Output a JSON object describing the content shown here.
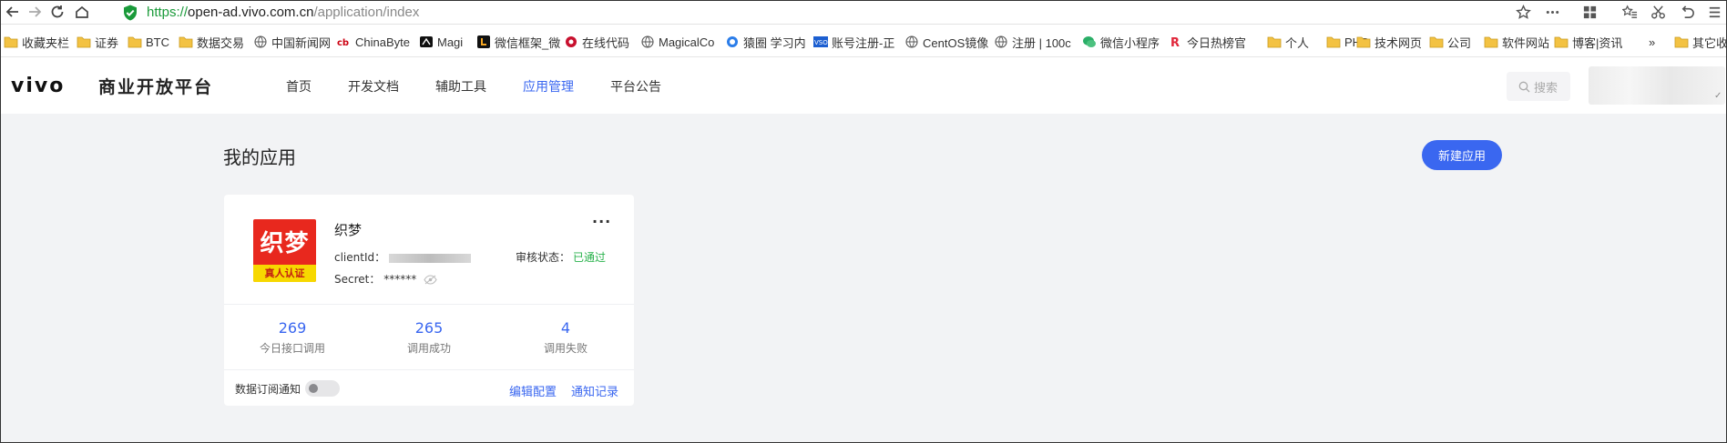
{
  "browser": {
    "url_scheme": "https://",
    "url_host": "open-ad.vivo.com.cn",
    "url_path": "/application/index",
    "icons": {
      "back": "arrow-left-icon",
      "forward": "arrow-right-icon",
      "reload": "reload-icon",
      "home": "home-icon",
      "secure": "shield-check-icon",
      "star": "star-icon",
      "menu_more": "more-icon",
      "apps": "grid-icon",
      "favorites": "favorites-icon",
      "cut": "scissors-icon",
      "undo": "undo-icon",
      "main_menu": "hamburger-icon"
    }
  },
  "bookmarks": [
    {
      "label": "收藏夹栏",
      "icon": "folder-icon"
    },
    {
      "label": "证券",
      "icon": "folder-icon"
    },
    {
      "label": "BTC",
      "icon": "folder-icon"
    },
    {
      "label": "数据交易",
      "icon": "folder-icon"
    },
    {
      "label": "中国新闻网",
      "icon": "globe-icon"
    },
    {
      "label": "ChinaByte",
      "icon": "cb-icon"
    },
    {
      "label": "Magi",
      "icon": "magi-icon"
    },
    {
      "label": "微信框架_微",
      "icon": "l-icon"
    },
    {
      "label": "在线代码",
      "icon": "circle-red-icon"
    },
    {
      "label": "MagicalCo",
      "icon": "globe-icon"
    },
    {
      "label": "猿圈 学习内",
      "icon": "blue-circle-icon"
    },
    {
      "label": "账号注册-正",
      "icon": "vso-icon"
    },
    {
      "label": "CentOS镜像",
      "icon": "globe-icon"
    },
    {
      "label": "注册 | 100c",
      "icon": "globe-icon"
    },
    {
      "label": "微信小程序",
      "icon": "wechat-icon"
    },
    {
      "label": "今日热榜官",
      "icon": "r-icon"
    },
    {
      "label": "个人",
      "icon": "folder-icon"
    },
    {
      "label": "PHP",
      "icon": "folder-icon"
    },
    {
      "label": "技术网页",
      "icon": "folder-icon"
    },
    {
      "label": "公司",
      "icon": "folder-icon"
    },
    {
      "label": "软件网站",
      "icon": "folder-icon"
    },
    {
      "label": "博客|资讯",
      "icon": "folder-icon"
    },
    {
      "label": "»",
      "icon": ""
    },
    {
      "label": "其它收",
      "icon": "folder-icon"
    }
  ],
  "header": {
    "logo_text": "vivo",
    "brand_title": "商业开放平台",
    "nav": [
      {
        "label": "首页",
        "active": false
      },
      {
        "label": "开发文档",
        "active": false
      },
      {
        "label": "辅助工具",
        "active": false
      },
      {
        "label": "应用管理",
        "active": true
      },
      {
        "label": "平台公告",
        "active": false
      }
    ],
    "search_placeholder": "搜索"
  },
  "main": {
    "title": "我的应用",
    "new_app_label": "新建应用"
  },
  "app_card": {
    "logo_text": "织梦",
    "logo_badge": "真人认证",
    "name": "织梦",
    "more_label": "···",
    "client_id_label": "clientId：",
    "secret_label": "Secret：",
    "secret_value": "******",
    "review_label": "审核状态：",
    "review_value": "已通过",
    "stats": [
      {
        "value": "269",
        "label": "今日接口调用"
      },
      {
        "value": "265",
        "label": "调用成功"
      },
      {
        "value": "4",
        "label": "调用失败"
      }
    ],
    "subscription_label": "数据订阅通知",
    "subscription_on": false,
    "edit_config_label": "编辑配置",
    "notify_log_label": "通知记录"
  },
  "colors": {
    "accent": "#3a67f0",
    "success": "#28b24b",
    "page_bg": "#f2f3f5",
    "logo_red": "#e8281e",
    "logo_yellow": "#f7d800"
  }
}
